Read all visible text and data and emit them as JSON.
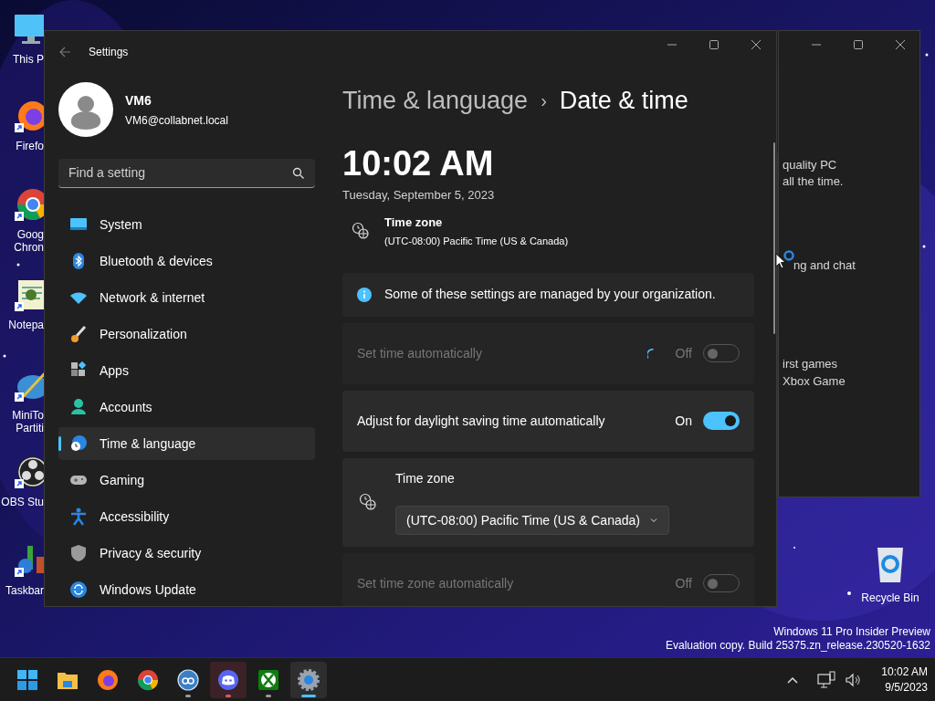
{
  "desktop_icons": [
    {
      "kind": "monitor",
      "lines": [
        "This P"
      ]
    },
    {
      "kind": "firefox",
      "lines": [
        "Firefo"
      ]
    },
    {
      "kind": "chrome",
      "lines": [
        "Goog",
        "Chron"
      ]
    },
    {
      "kind": "notepad",
      "lines": [
        "Notepa"
      ]
    },
    {
      "kind": "minitool",
      "lines": [
        "MiniTo",
        "Partiti"
      ]
    },
    {
      "kind": "obs",
      "lines": [
        "OBS Stu"
      ]
    },
    {
      "kind": "taskbar",
      "lines": [
        "Taskbar"
      ]
    }
  ],
  "background_window": {
    "texts": [
      "quality PC",
      "all the time.",
      "ng and chat",
      "irst games",
      "Xbox Game"
    ]
  },
  "settings": {
    "title": "Settings",
    "user": {
      "name": "VM6",
      "email": "VM6@collabnet.local"
    },
    "search": {
      "placeholder": "Find a setting"
    },
    "nav": [
      {
        "kind": "system",
        "label": "System",
        "selected": false
      },
      {
        "kind": "bluetooth",
        "label": "Bluetooth & devices",
        "selected": false
      },
      {
        "kind": "network",
        "label": "Network & internet",
        "selected": false
      },
      {
        "kind": "personalization",
        "label": "Personalization",
        "selected": false
      },
      {
        "kind": "apps",
        "label": "Apps",
        "selected": false
      },
      {
        "kind": "accounts",
        "label": "Accounts",
        "selected": false
      },
      {
        "kind": "time",
        "label": "Time & language",
        "selected": true
      },
      {
        "kind": "gaming",
        "label": "Gaming",
        "selected": false
      },
      {
        "kind": "accessibility",
        "label": "Accessibility",
        "selected": false
      },
      {
        "kind": "privacy",
        "label": "Privacy & security",
        "selected": false
      },
      {
        "kind": "update",
        "label": "Windows Update",
        "selected": false
      }
    ],
    "breadcrumb": {
      "parent": "Time & language",
      "separator": "›",
      "current": "Date & time"
    },
    "time": "10:02 AM",
    "date": "Tuesday, September 5, 2023",
    "time_zone": {
      "label": "Time zone",
      "value": "(UTC-08:00) Pacific Time (US & Canada)"
    },
    "rows": [
      {
        "kind": "notice",
        "text": "Some of these settings are managed by your organization."
      },
      {
        "kind": "toggle",
        "label": "Set time automatically",
        "state_text": "Off",
        "on": false,
        "disabled": true,
        "busy": true
      },
      {
        "kind": "toggle",
        "label": "Adjust for daylight saving time automatically",
        "state_text": "On",
        "on": true,
        "disabled": false,
        "busy": false
      },
      {
        "kind": "dropdown",
        "label": "Time zone",
        "value": "(UTC-08:00) Pacific Time (US & Canada)"
      },
      {
        "kind": "toggle",
        "label": "Set time zone automatically",
        "state_text": "Off",
        "on": false,
        "disabled": true,
        "busy": false
      }
    ]
  },
  "recycle_bin": {
    "label": "Recycle Bin"
  },
  "edition_lines": [
    "Windows 11 Pro Insider Preview",
    "Evaluation copy. Build 25375.zn_release.230520-1632"
  ],
  "taskbar": {
    "apps": [
      {
        "kind": "start",
        "running": false,
        "active": false,
        "flashing": false
      },
      {
        "kind": "explorer",
        "running": false,
        "active": false,
        "flashing": false
      },
      {
        "kind": "firefox",
        "running": false,
        "active": false,
        "flashing": false
      },
      {
        "kind": "chrome",
        "running": false,
        "active": false,
        "flashing": false
      },
      {
        "kind": "qbittorrent",
        "running": true,
        "active": false,
        "flashing": false
      },
      {
        "kind": "discord",
        "running": true,
        "active": false,
        "flashing": true
      },
      {
        "kind": "xbox",
        "running": true,
        "active": false,
        "flashing": false
      },
      {
        "kind": "settings",
        "running": true,
        "active": true,
        "flashing": false
      }
    ],
    "clock": {
      "time": "10:02 AM",
      "date": "9/5/2023"
    }
  }
}
